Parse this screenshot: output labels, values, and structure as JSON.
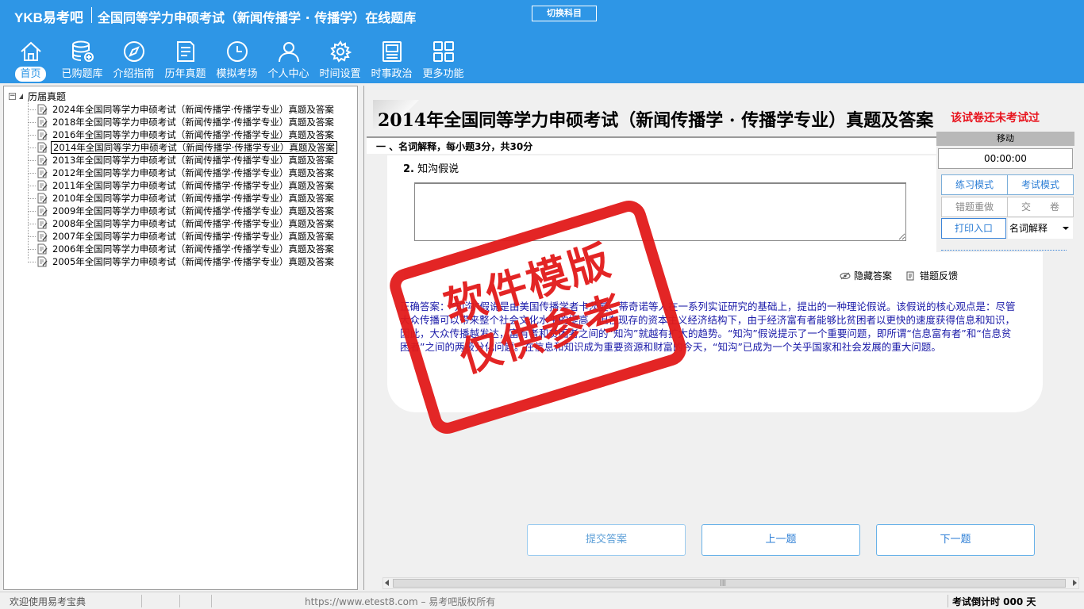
{
  "header": {
    "logo_latin": "YKB",
    "logo_cn": "易考吧",
    "title": "全国同等学力申硕考试（新闻传播学 · 传播学）在线题库",
    "switch_label": "切换科目"
  },
  "nav": [
    {
      "label": "首页",
      "icon": "home-icon"
    },
    {
      "label": "已购题库",
      "icon": "database-icon"
    },
    {
      "label": "介绍指南",
      "icon": "compass-icon"
    },
    {
      "label": "历年真题",
      "icon": "document-list-icon"
    },
    {
      "label": "模拟考场",
      "icon": "clock-icon"
    },
    {
      "label": "个人中心",
      "icon": "user-icon"
    },
    {
      "label": "时间设置",
      "icon": "gear-icon"
    },
    {
      "label": "时事政治",
      "icon": "news-icon"
    },
    {
      "label": "更多功能",
      "icon": "grid-icon"
    }
  ],
  "tree": {
    "root": "历届真题",
    "items": [
      "2024年全国同等学力申硕考试（新闻传播学·传播学专业）真题及答案",
      "2018年全国同等学力申硕考试（新闻传播学·传播学专业）真题及答案",
      "2016年全国同等学力申硕考试（新闻传播学·传播学专业）真题及答案",
      "2014年全国同等学力申硕考试（新闻传播学·传播学专业）真题及答案",
      "2013年全国同等学力申硕考试（新闻传播学·传播学专业）真题及答案",
      "2012年全国同等学力申硕考试（新闻传播学·传播学专业）真题及答案",
      "2011年全国同等学力申硕考试（新闻传播学·传播学专业）真题及答案",
      "2010年全国同等学力申硕考试（新闻传播学·传播学专业）真题及答案",
      "2009年全国同等学力申硕考试（新闻传播学·传播学专业）真题及答案",
      "2008年全国同等学力申硕考试（新闻传播学·传播学专业）真题及答案",
      "2007年全国同等学力申硕考试（新闻传播学·传播学专业）真题及答案",
      "2006年全国同等学力申硕考试（新闻传播学·传播学专业）真题及答案",
      "2005年全国同等学力申硕考试（新闻传播学·传播学专业）真题及答案"
    ]
  },
  "paper": {
    "title": "2014年全国同等学力申硕考试（新闻传播学 · 传播学专业）真题及答案",
    "notice": "该试卷还未考试过",
    "section": "一 、名词解释，每小题3分，共30分",
    "question_number": "2.",
    "question_text": "知沟假说",
    "hide_answer": "隐藏答案",
    "report_error": "错题反馈",
    "answer": "正确答案：“知沟”假说是由美国传播学者卡茨曼、蒂奇诺等人在一系列实证研究的基础上，提出的一种理论假说。该假说的核心观点是：尽管大众传播可以带来整个社会文化水平的提高，但在现存的资本主义经济结构下，由于经济富有者能够比贫困者以更快的速度获得信息和知识，因此，大众传播越发达，富有者和贫困者之间的“知沟”就越有扩大的趋势。“知沟”假说提示了一个重要问题，即所谓“信息富有者”和“信息贫困者”之间的两极分化问题。在信息和知识成为重要资源和财富的今天，“知沟”已成为一个关乎国家和社会发展的重大问题。"
  },
  "timer": {
    "move_label": "移动",
    "display": "00:00:00",
    "practice_mode": "练习模式",
    "exam_mode": "考试模式",
    "redo_wrong": "错题重做",
    "submit_paper": "交　　卷",
    "print_entry": "打印入口",
    "type_selected": "名词解释"
  },
  "actions": {
    "submit": "提交答案",
    "prev": "上一题",
    "next": "下一题"
  },
  "watermark": {
    "line1": "软件模版",
    "line2": "仅供参考"
  },
  "status": {
    "welcome": "欢迎使用易考宝典",
    "url": "https://www.etest8.com – 易考吧版权所有",
    "countdown": "考试倒计时 000 天"
  },
  "colors": {
    "header_bg": "#2e96e6",
    "accent_blue": "#2e7fd6",
    "notice_red": "#e8141e",
    "answer_text": "#1a1aa8"
  }
}
